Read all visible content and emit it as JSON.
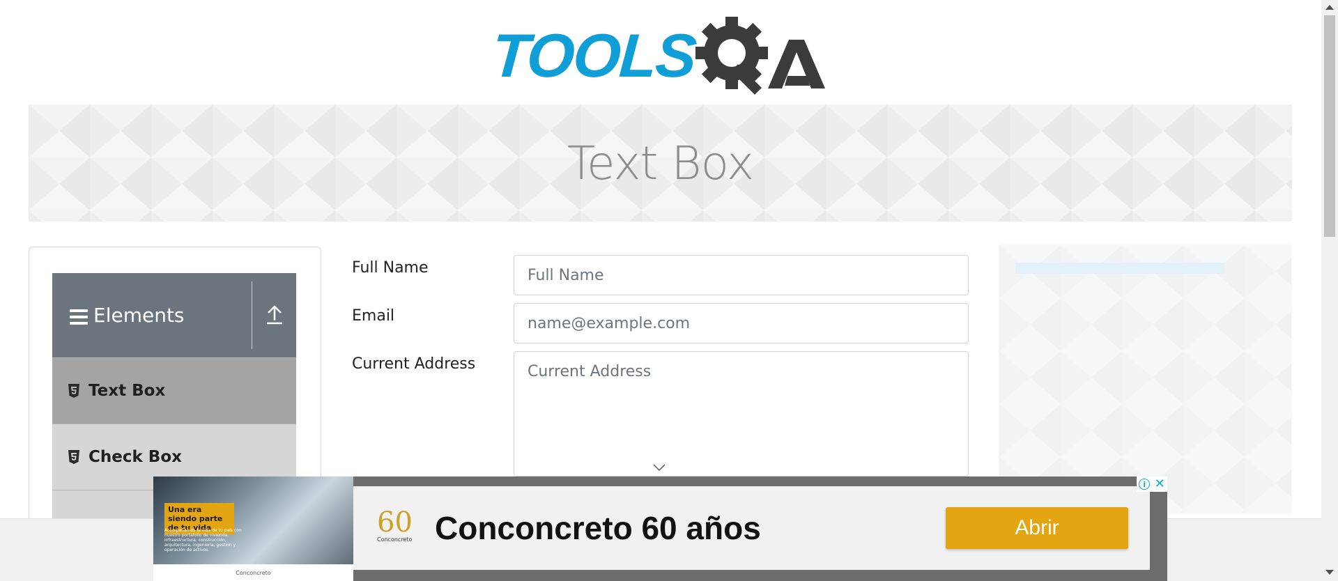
{
  "header": {
    "logo_text": "TOOLSQA"
  },
  "banner": {
    "title": "Text Box"
  },
  "sidebar": {
    "group_title": "Elements",
    "items": [
      {
        "label": "Text Box",
        "active": true
      },
      {
        "label": "Check Box",
        "active": false
      }
    ]
  },
  "form": {
    "full_name": {
      "label": "Full Name",
      "placeholder": "Full Name",
      "value": ""
    },
    "email": {
      "label": "Email",
      "placeholder": "name@example.com",
      "value": ""
    },
    "current_address": {
      "label": "Current Address",
      "placeholder": "Current Address",
      "value": ""
    }
  },
  "ad": {
    "photo_tag": "Una era siendo parte de tu vida",
    "photo_small": "Acompañamos la vida de tu país con nuestro portafolio de vivienda, infraestructura, construcción, arquitectura, ingeniería, gestión y operación de activos.",
    "photo_footer": "Conconcreto",
    "logo_number": "60",
    "logo_brand": "Conconcreto",
    "headline": "Conconcreto 60 años",
    "cta": "Abrir",
    "info_icon": "i",
    "close_icon": "✕"
  },
  "colors": {
    "brand_blue": "#0f9fd6",
    "brand_gray": "#3b3b3b",
    "sidebar_header": "#6c757d",
    "active_item": "#a4a4a4",
    "ad_button": "#e3a511"
  }
}
